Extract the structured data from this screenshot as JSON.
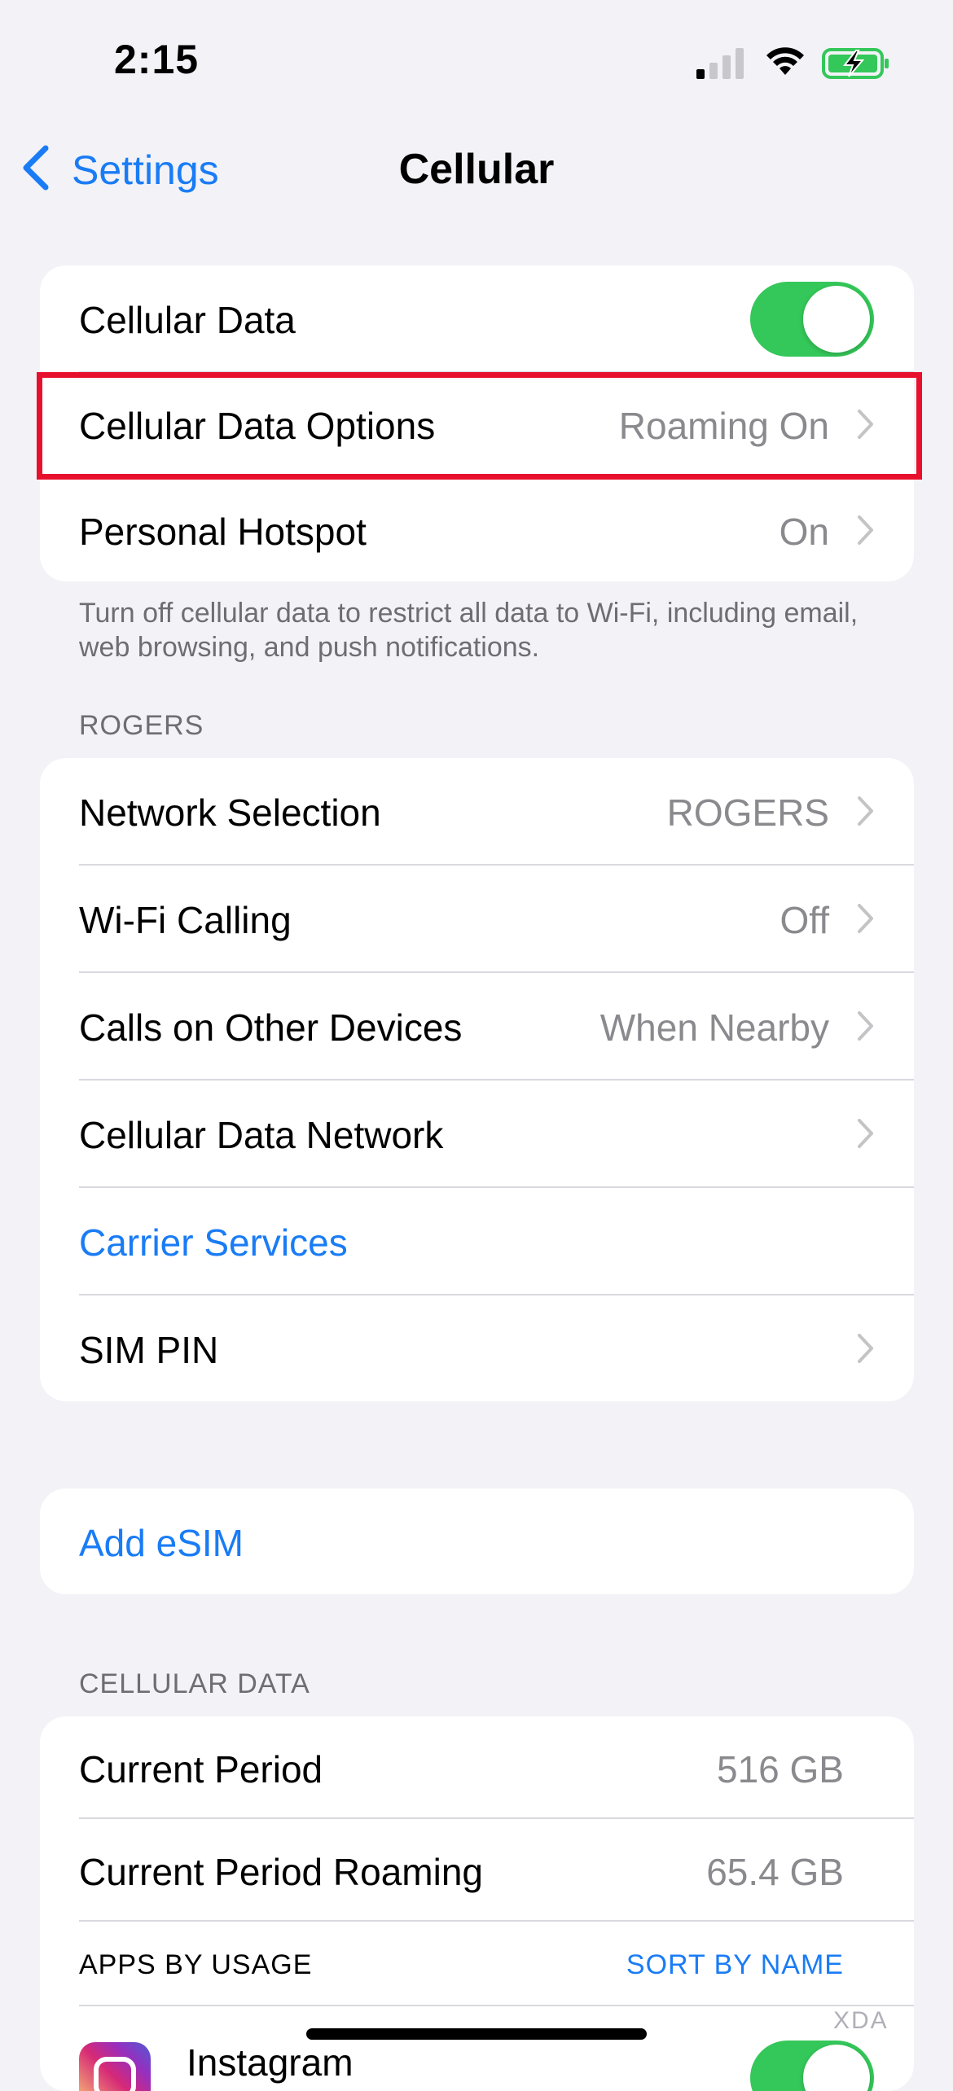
{
  "status_bar": {
    "time": "2:15",
    "signal_icon": "cellular-signal-icon",
    "wifi_icon": "wifi-icon",
    "battery_icon": "battery-charging-icon"
  },
  "nav": {
    "back_label": "Settings",
    "title": "Cellular"
  },
  "group1": {
    "cellular_data": {
      "label": "Cellular Data",
      "toggle_on": true
    },
    "cellular_data_options": {
      "label": "Cellular Data Options",
      "value": "Roaming On",
      "highlighted": true
    },
    "personal_hotspot": {
      "label": "Personal Hotspot",
      "value": "On"
    },
    "footnote": "Turn off cellular data to restrict all data to Wi-Fi, including email, web browsing, and push notifications."
  },
  "rogers": {
    "header": "ROGERS",
    "network_selection": {
      "label": "Network Selection",
      "value": "ROGERS"
    },
    "wifi_calling": {
      "label": "Wi-Fi Calling",
      "value": "Off"
    },
    "calls_other_devices": {
      "label": "Calls on Other Devices",
      "value": "When Nearby"
    },
    "cellular_data_network": {
      "label": "Cellular Data Network"
    },
    "carrier_services": {
      "label": "Carrier Services"
    },
    "sim_pin": {
      "label": "SIM PIN"
    }
  },
  "esim": {
    "label": "Add eSIM"
  },
  "usage": {
    "header": "CELLULAR DATA",
    "current_period": {
      "label": "Current Period",
      "value": "516 GB"
    },
    "current_period_roaming": {
      "label": "Current Period Roaming",
      "value": "65.4 GB"
    },
    "apps_by_usage": "APPS BY USAGE",
    "sort_by": "SORT BY NAME",
    "first_app": {
      "label": "Instagram",
      "toggle_on": true
    }
  },
  "watermark": "XDA",
  "colors": {
    "accent": "#1a7cf5",
    "toggle_on": "#34c759",
    "highlight": "#e8112d",
    "background": "#f2f2f7"
  }
}
